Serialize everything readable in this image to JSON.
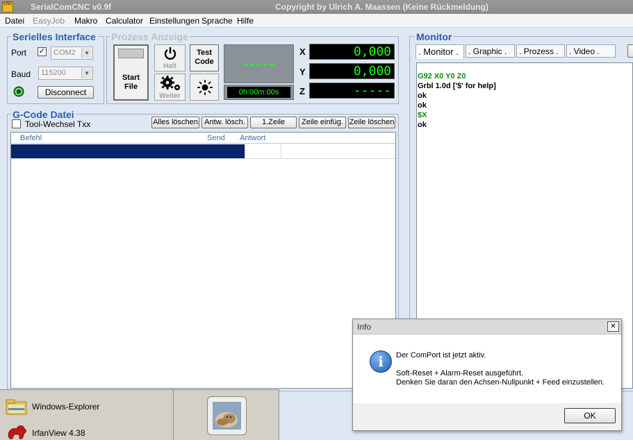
{
  "titlebar": {
    "icon_text": "CNC",
    "title": "SerialComCNC  v0.9f",
    "copyright": "Copyright by Ulrich A. Maassen (Keine Rückmeldung)"
  },
  "menu": {
    "datei": "Datei",
    "easyjob": "EasyJob",
    "makro": "Makro",
    "calculator": "Calculator",
    "einstellungen": "Einstellungen",
    "sprache": "Sprache",
    "hilfe": "Hilfe"
  },
  "serial": {
    "title": "Serielles Interface",
    "port_label": "Port",
    "port_value": "COM2",
    "baud_label": "Baud",
    "baud_value": "115200",
    "disconnect_label": "Disconnect"
  },
  "process": {
    "title": "Prozess Anzeige",
    "start_line1": "Start",
    "start_line2": "File",
    "halt_label": "Halt",
    "weiter_label": "Weiter",
    "test_line1": "Test",
    "test_line2": "Code",
    "status_display": "-----",
    "timer": "0h:00m:00s",
    "x_label": "X",
    "x_value": "0,000",
    "y_label": "Y",
    "y_value": "0,000",
    "z_label": "Z",
    "z_value": "-----"
  },
  "gcode": {
    "title": "G-Code Datei",
    "tool_change_label": "Tool-Wechsel Txx",
    "buttons": {
      "clear_all": "Alles löschen",
      "clear_answers": "Antw. lösch.",
      "first_line": "1.Zeile",
      "insert_line": "Zeile einfüg.",
      "delete_line": "Zeile löschen"
    },
    "columns": {
      "befehl": "Befehl",
      "send": "Send",
      "antwort": "Antwort"
    }
  },
  "monitor": {
    "title": "Monitor",
    "tabs": [
      ". Monitor .",
      ". Graphic .",
      ". Prozess .",
      ". Video ."
    ],
    "lines": [
      {
        "text": "G92 X0 Y0 Z0",
        "color": "green"
      },
      {
        "text": "Grbl 1.0d ['$' for help]",
        "color": "black"
      },
      {
        "text": "ok",
        "color": "black"
      },
      {
        "text": "ok",
        "color": "black"
      },
      {
        "text": "$X",
        "color": "green"
      },
      {
        "text": "ok",
        "color": "black"
      }
    ]
  },
  "dialog": {
    "title": "Info",
    "close_glyph": "✕",
    "icon_glyph": "i",
    "line1": "Der ComPort ist jetzt aktiv.",
    "line2": "Soft-Reset + Alarm-Reset ausgeführt.",
    "line3": "Denken Sie daran den Achsen-Nullpunkt + Feed einzustellen.",
    "ok_label": "OK"
  },
  "taskbar_popup": {
    "items": [
      "Windows-Explorer",
      "IrfanView 4.38"
    ]
  },
  "colors": {
    "accent_blue": "#2b5ea8",
    "dro_green": "#1cff1c",
    "selection_row": "#0a2468",
    "monitor_green": "#0d8a0d"
  }
}
